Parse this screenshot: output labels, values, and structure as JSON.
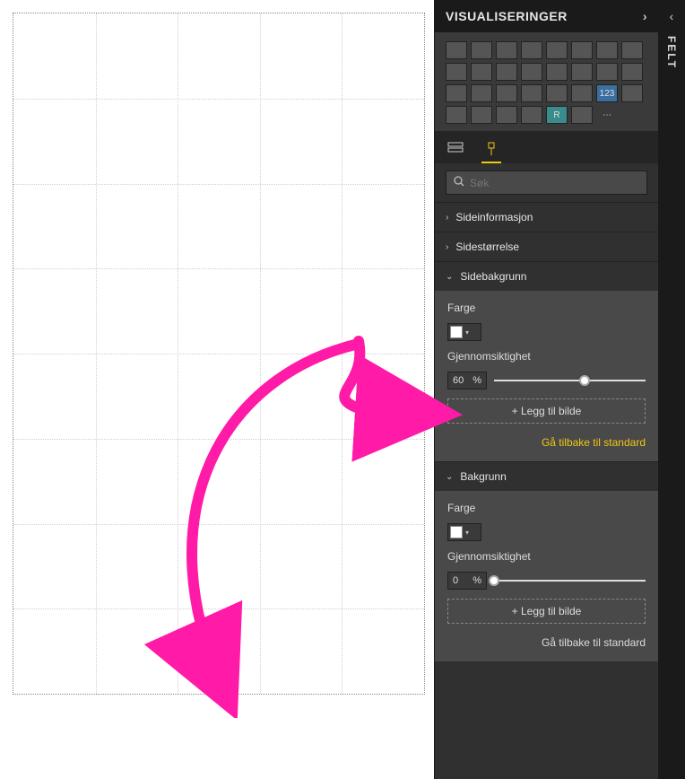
{
  "panel": {
    "title": "VISUALISERINGER"
  },
  "collapsed_panel": {
    "title": "FELT"
  },
  "search": {
    "placeholder": "Søk"
  },
  "sections": {
    "page_info": {
      "label": "Sideinformasjon"
    },
    "page_size": {
      "label": "Sidestørrelse"
    },
    "page_bg": {
      "label": "Sidebakgrunn",
      "color_label": "Farge",
      "transparency_label": "Gjennomsiktighet",
      "transparency_value": "60",
      "transparency_unit": "%",
      "add_image": "+ Legg til bilde",
      "reset": "Gå tilbake til standard"
    },
    "bg": {
      "label": "Bakgrunn",
      "color_label": "Farge",
      "transparency_label": "Gjennomsiktighet",
      "transparency_value": "0",
      "transparency_unit": "%",
      "add_image": "+ Legg til bilde",
      "reset": "Gå tilbake til standard"
    }
  }
}
